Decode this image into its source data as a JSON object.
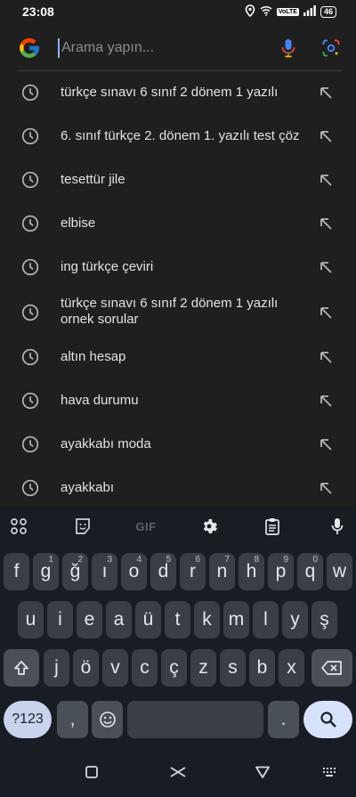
{
  "status_bar": {
    "time": "23:08",
    "network_badge": "VoLTE",
    "battery": "46",
    "icons": [
      "location-icon",
      "wifi-icon",
      "signal-icon",
      "battery-icon"
    ]
  },
  "search": {
    "placeholder": "Arama yapın...",
    "value": ""
  },
  "suggestions": [
    {
      "text": "türkçe sınavı 6 sınıf 2 dönem 1 yazılı"
    },
    {
      "text": "6. sınıf türkçe 2. dönem 1. yazılı test çöz"
    },
    {
      "text": "tesettür jile"
    },
    {
      "text": "elbise"
    },
    {
      "text": "ing türkçe çeviri"
    },
    {
      "text": "türkçe sınavı 6 sınıf 2 dönem 1 yazılı ornek sorular"
    },
    {
      "text": "altın hesap"
    },
    {
      "text": "hava durumu"
    },
    {
      "text": "ayakkabı moda"
    },
    {
      "text": "ayakkabı"
    }
  ],
  "keyboard": {
    "toolbar": {
      "gif": "GIF"
    },
    "row1": [
      {
        "key": "f",
        "hint": ""
      },
      {
        "key": "g",
        "hint": "1"
      },
      {
        "key": "ğ",
        "hint": "2"
      },
      {
        "key": "ı",
        "hint": "3"
      },
      {
        "key": "o",
        "hint": "4"
      },
      {
        "key": "d",
        "hint": "5"
      },
      {
        "key": "r",
        "hint": "6"
      },
      {
        "key": "n",
        "hint": "7"
      },
      {
        "key": "h",
        "hint": "8"
      },
      {
        "key": "p",
        "hint": "9"
      },
      {
        "key": "q",
        "hint": "0"
      },
      {
        "key": "w",
        "hint": ""
      }
    ],
    "row2": [
      "u",
      "i",
      "e",
      "a",
      "ü",
      "t",
      "k",
      "m",
      "l",
      "y",
      "ş"
    ],
    "row3": [
      "j",
      "ö",
      "v",
      "c",
      "ç",
      "z",
      "s",
      "b",
      "x"
    ],
    "row4": {
      "symbols": "?123",
      "comma": ",",
      "period": "."
    }
  },
  "colors": {
    "background": "#1f1f1f",
    "keyboard_bg": "#181d24",
    "key_bg": "#3a3f47",
    "accent": "#c9d4ec"
  }
}
